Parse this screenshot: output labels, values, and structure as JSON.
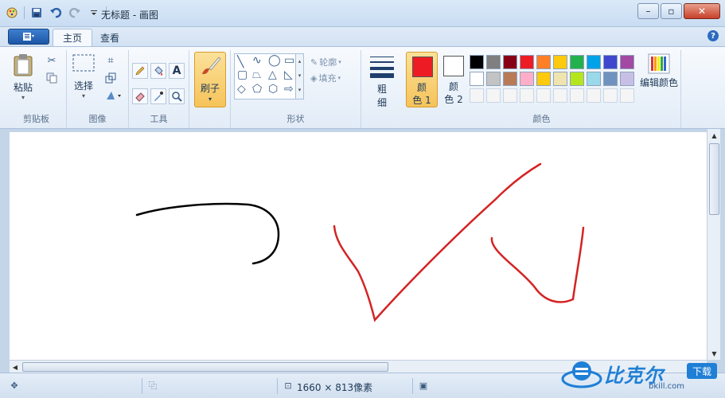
{
  "window": {
    "title": "无标题 - 画图",
    "buttons": [
      "minimize",
      "maximize",
      "close"
    ]
  },
  "quick_access": [
    "app-icon",
    "save-icon",
    "undo-icon",
    "redo-icon",
    "dropdown-icon"
  ],
  "tabs": [
    {
      "label": "主页",
      "active": true
    },
    {
      "label": "查看",
      "active": false
    }
  ],
  "ribbon": {
    "clipboard": {
      "group_label": "剪贴板",
      "paste_label": "粘贴"
    },
    "image": {
      "group_label": "图像",
      "select_label": "选择"
    },
    "tools": {
      "group_label": "工具"
    },
    "brushes": {
      "label": "刷子"
    },
    "shapes": {
      "group_label": "形状",
      "outline_label": "轮廓",
      "fill_label": "填充"
    },
    "size": {
      "label_top": "粗",
      "label_bottom": "细"
    },
    "colors": {
      "group_label": "颜色",
      "color1_top": "颜",
      "color1_bottom": "色 1",
      "color2_top": "颜",
      "color2_bottom": "色 2",
      "color1_value": "#ed1c24",
      "color2_value": "#ffffff",
      "edit_label": "编辑颜色",
      "palette_row1": [
        "#000000",
        "#7f7f7f",
        "#880015",
        "#ed1c24",
        "#ff7f27",
        "#ffc90e",
        "#22b14c",
        "#00a2e8",
        "#3f48cc",
        "#a349a4"
      ],
      "palette_row2": [
        "#ffffff",
        "#c3c3c3",
        "#b97a57",
        "#ffaec9",
        "#ffc90e",
        "#efe4b0",
        "#b5e61d",
        "#99d9ea",
        "#7092be",
        "#c8bfe7"
      ],
      "palette_row3": [
        "#f5f5f5",
        "#f5f5f5",
        "#f5f5f5",
        "#f5f5f5",
        "#f5f5f5",
        "#f5f5f5",
        "#f5f5f5",
        "#f5f5f5",
        "#f5f5f5",
        "#f5f5f5"
      ]
    }
  },
  "status": {
    "canvas_size": "1660 × 813像素"
  },
  "watermark": {
    "text": "比克尔",
    "tag": "下载",
    "url": "bkill.com"
  }
}
